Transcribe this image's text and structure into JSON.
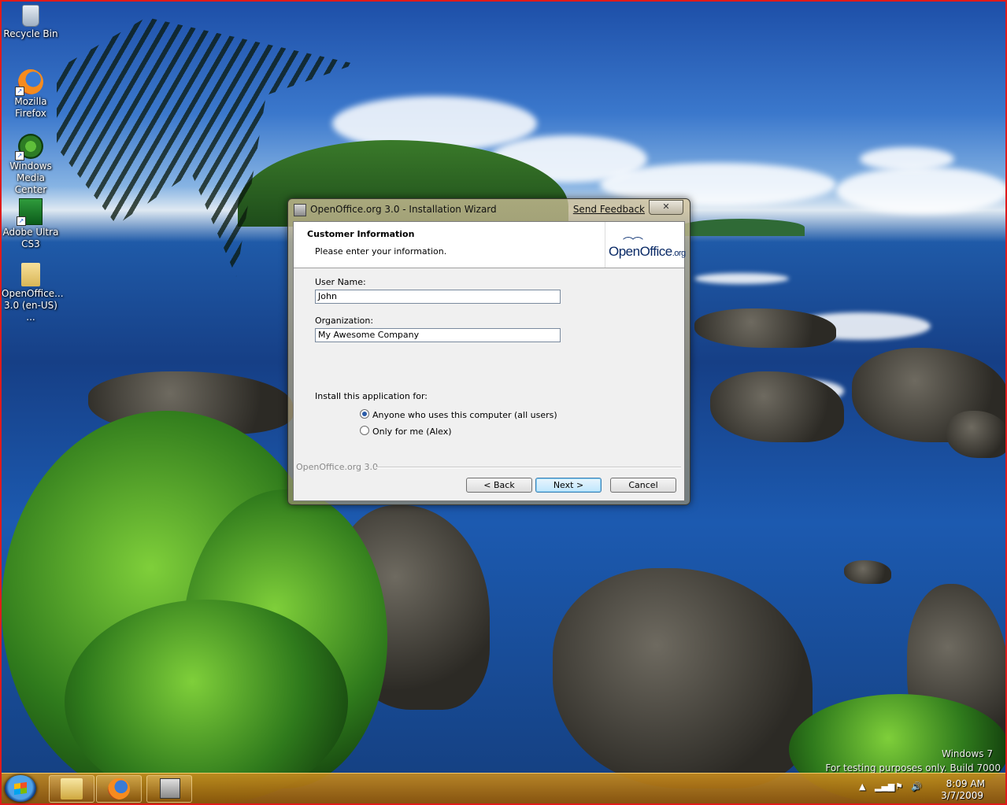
{
  "desktop": {
    "icons": [
      {
        "label": "Recycle Bin"
      },
      {
        "label": "Mozilla Firefox"
      },
      {
        "label": "Windows Media Center"
      },
      {
        "label": "Adobe Ultra CS3"
      },
      {
        "label": "OpenOffice... 3.0 (en-US) ..."
      }
    ],
    "watermark": {
      "line1": "Windows 7",
      "line2": "For testing purposes only. Build 7000"
    }
  },
  "dialog": {
    "title": "OpenOffice.org 3.0 - Installation Wizard",
    "feedback_link": "Send Feedback",
    "close_glyph": "✕",
    "banner": {
      "title": "Customer Information",
      "subtitle": "Please enter your information.",
      "logo_main": "OpenOffice",
      "logo_suffix": ".org"
    },
    "fields": {
      "user_name_label": "User Name:",
      "user_name_value": "John",
      "organization_label": "Organization:",
      "organization_value": "My Awesome Company"
    },
    "install_for": {
      "label": "Install this application for:",
      "options": [
        {
          "label": "Anyone who uses this computer (all users)",
          "selected": true
        },
        {
          "label": "Only for me (Alex)",
          "selected": false
        }
      ]
    },
    "footer_brand": "OpenOffice.org 3.0",
    "buttons": {
      "back": "< Back",
      "next": "Next >",
      "cancel": "Cancel"
    }
  },
  "taskbar": {
    "pinned": [
      "windows-explorer-icon",
      "firefox-icon",
      "installer-icon"
    ],
    "clock": {
      "time": "8:09 AM",
      "date": "3/7/2009"
    }
  }
}
